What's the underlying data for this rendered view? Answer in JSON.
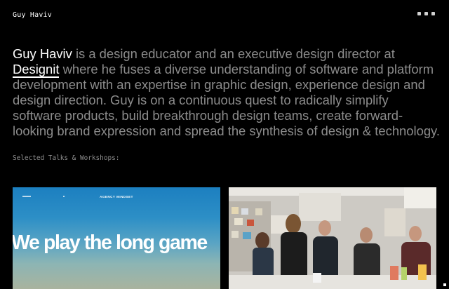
{
  "header": {
    "site_name": "Guy Haviv",
    "social_icons": [
      "dribbble-icon",
      "email-icon",
      "linkedin-icon"
    ]
  },
  "bio": {
    "name": "Guy Haviv",
    "text_before_company": " is a design educator and an executive design director at ",
    "company": "Designit",
    "text_after_company": " where he fuses a diverse understanding of software and platform development with an expertise in graphic design, experience design and design direction. Guy is on a continuous quest to radically simplify software products, build breakthrough design teams, create forward-looking brand expression and spread the synthesis of design & technology."
  },
  "talks": {
    "section_label": "Selected Talks & Workshops:",
    "items": [
      {
        "kicker": "AGENCY MINDSET",
        "headline": "We play the long game"
      },
      {
        "image": "workshop-photo"
      }
    ]
  }
}
